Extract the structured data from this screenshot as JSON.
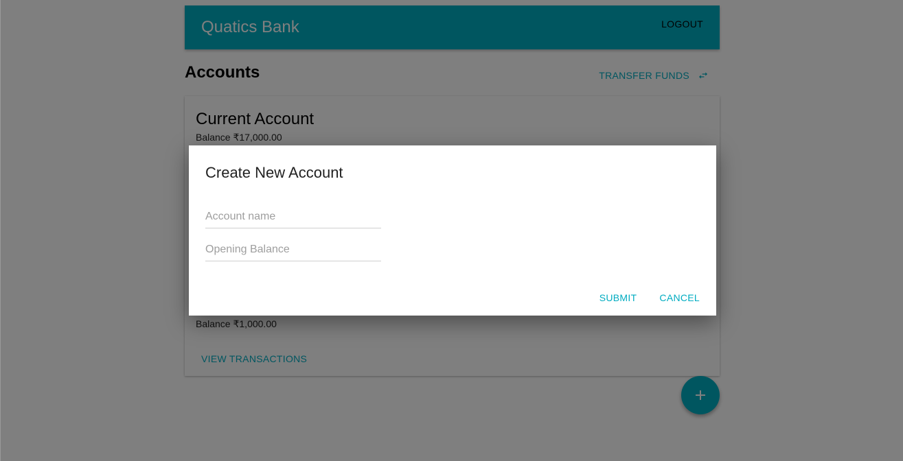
{
  "app": {
    "brand": "Quatics Bank",
    "logout_label": "LOGOUT",
    "accent_color": "#00acc1"
  },
  "accounts": {
    "title": "Accounts",
    "transfer_label": "TRANSFER FUNDS",
    "transfer_icon": "swap-horiz-icon",
    "items": [
      {
        "name": "Current Account",
        "balance": "Balance ₹17,000.00"
      },
      {
        "balance": "Balance ₹1,000.00",
        "view_label": "VIEW TRANSACTIONS"
      }
    ],
    "fab_icon": "add-icon"
  },
  "dialog": {
    "title": "Create New Account",
    "account_name_placeholder": "Account name",
    "account_name_value": "",
    "opening_balance_placeholder": "Opening Balance",
    "opening_balance_value": "",
    "submit_label": "SUBMIT",
    "cancel_label": "CANCEL"
  }
}
